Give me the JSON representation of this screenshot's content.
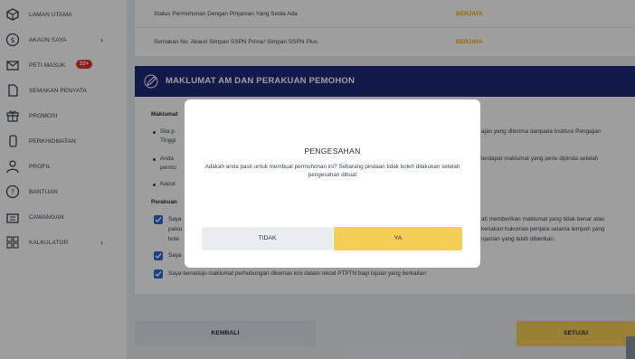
{
  "sidebar": {
    "items": [
      {
        "label": "LAMAN UTAMA",
        "icon": "home-icon"
      },
      {
        "label": "AKAUN SAYA",
        "icon": "dollar-icon",
        "chevron": "›"
      },
      {
        "label": "PETI MASUK",
        "icon": "mail-icon",
        "badge": "10+"
      },
      {
        "label": "SEMAKAN PENYATA",
        "icon": "document-icon"
      },
      {
        "label": "PROMOSI",
        "icon": "gift-icon"
      },
      {
        "label": "PERKHIDMATAN",
        "icon": "phone-icon"
      },
      {
        "label": "PROFIL",
        "icon": "user-icon"
      },
      {
        "label": "BANTUAN",
        "icon": "help-icon"
      },
      {
        "label": "CAWANGAN",
        "icon": "building-icon"
      },
      {
        "label": "KALKULATOR",
        "icon": "calculator-icon",
        "chevron": "›"
      }
    ]
  },
  "status": {
    "rows": [
      {
        "label": "Status Permohonan Dengan Pinjaman Yang Sedia Ada",
        "value": "BERJAYA"
      },
      {
        "label": "Semakan No. Akaun Simpan SSPN Prime/ Simpan SSPN Plus",
        "value": "BERJAYA"
      }
    ]
  },
  "section": {
    "title": "MAKLUMAT AM DAN PERAKUAN PEMOHON",
    "maklumat_heading": "Maklumat",
    "bullet1_left": "Sila p",
    "bullet1_left2": "Tinggi",
    "bullet1_right": "ajan yang diterima daripada Institusi Pengajian",
    "bullet2_left": "Anda",
    "bullet2_left2": "permo",
    "bullet2_right": "terdapat maklumat yang perlu dipinda setelah",
    "bullet3_left": "Keput",
    "perakuan_heading": "Perakuan",
    "check1_left": "Saya",
    "check1_left2": "palsu",
    "check1_left3": "bole",
    "check1_right": "ati memberikan maklumat yang tidak benar atau",
    "check1_right2": "kenakan hukuman penjara selama tempoh yang",
    "check1_right3": "njaman yang telah diberikan",
    "check2_left": "Saya",
    "check3": "Saya bersetuju maklumat perhubungan dikemas kini dalam rekod PTPTN bagi tujuan yang berkaitan"
  },
  "buttons": {
    "back": "KEMBALI",
    "agree": "SETUJU"
  },
  "modal": {
    "title": "PENGESAHAN",
    "message": "Adakah anda pasti untuk membuat permohonan ini? Sebarang pindaan tidak boleh dilakukan setelah pengesahan dibuat",
    "no": "TIDAK",
    "yes": "YA"
  },
  "colors": {
    "navy": "#1d2a7a",
    "yellow": "#f5cf55",
    "success": "#f2a900",
    "badge": "#e8322d"
  }
}
